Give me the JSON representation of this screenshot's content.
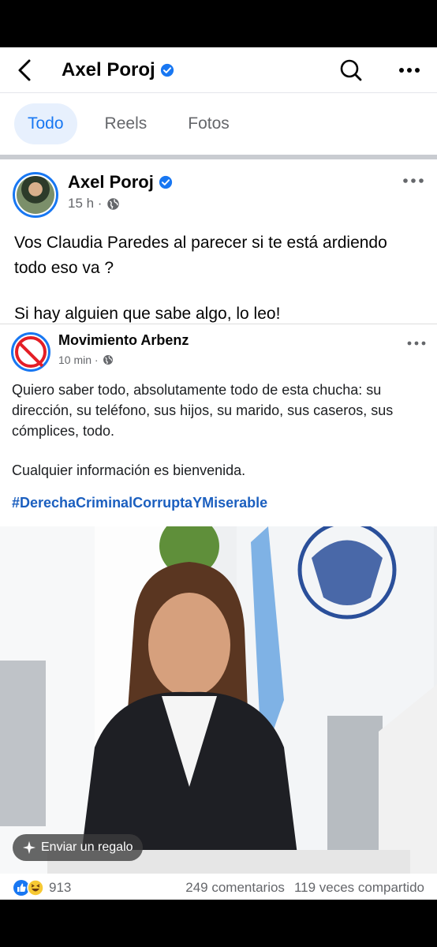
{
  "header": {
    "title": "Axel Poroj"
  },
  "tabs": [
    {
      "label": "Todo"
    },
    {
      "label": "Reels"
    },
    {
      "label": "Fotos"
    }
  ],
  "post": {
    "author": "Axel Poroj",
    "time": "15 h ·",
    "paragraphs": [
      "Vos Claudia Paredes al parecer si te está ardiendo todo eso va ?",
      "Si hay alguien que sabe algo, lo leo!"
    ]
  },
  "shared_post": {
    "author": "Movimiento Arbenz",
    "time": "10 min ·",
    "paragraphs": [
      "Quiero saber todo, absolutamente todo de esta chucha: su dirección, su teléfono, sus hijos, su marido, sus caseros, sus cómplices, todo.",
      "Cualquier información es bienvenida."
    ],
    "hashtag": "#DerechaCriminalCorruptaYMiserable",
    "gift_label": "Enviar un regalo"
  },
  "reactions": {
    "count": "913",
    "comments": "249 comentarios",
    "shares": "119 veces compartido"
  },
  "colors": {
    "accent": "#1877f2",
    "tab_active_bg": "#e7f0fd",
    "secondary_text": "#65676b"
  }
}
